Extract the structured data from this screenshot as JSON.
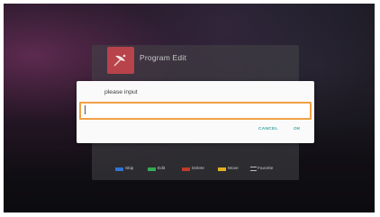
{
  "background_screen": {
    "title": "Program Edit",
    "logo_icon": "satellite-dish-icon",
    "logo_color": "#b8434b",
    "legend": [
      {
        "key": "skip",
        "label": "Skip",
        "color": "#2f74d0"
      },
      {
        "key": "edit",
        "label": "Edit",
        "color": "#34a853"
      },
      {
        "key": "delete",
        "label": "Delete",
        "color": "#c0392b"
      },
      {
        "key": "move",
        "label": "Move",
        "color": "#e0b020"
      },
      {
        "key": "favorite",
        "label": "Favorite",
        "icon": "favorite-icon"
      }
    ]
  },
  "dialog": {
    "title": "please input",
    "input_value": "",
    "input_border_color": "#f0a046",
    "cancel_label": "CANCEL",
    "ok_label": "OK",
    "action_color": "#3aa7a3"
  }
}
